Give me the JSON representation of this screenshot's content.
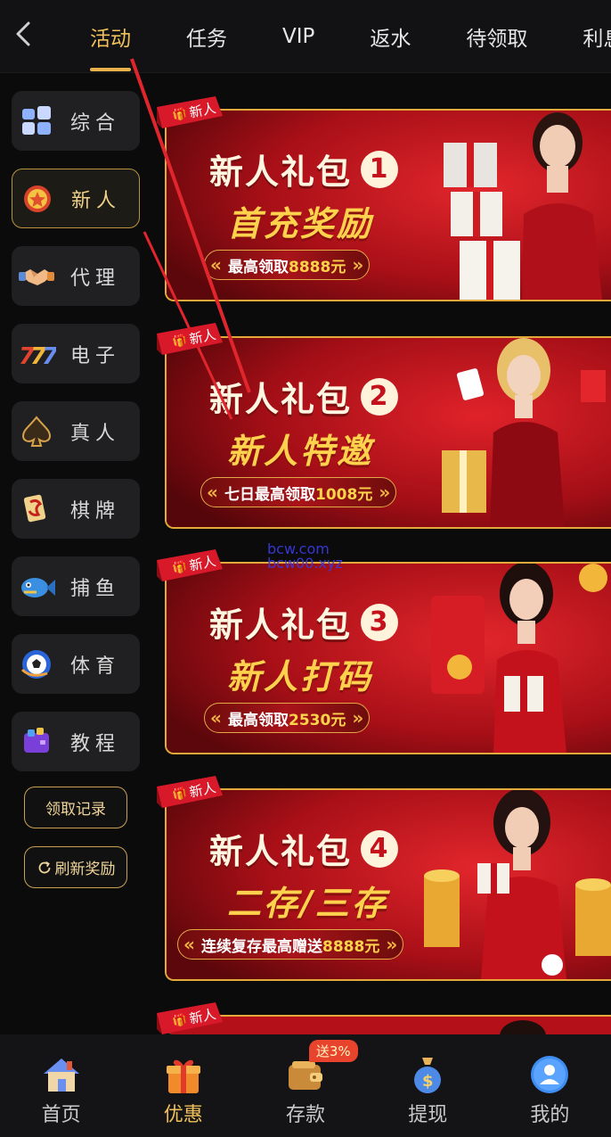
{
  "topbar": {
    "tabs": [
      {
        "label": "活动",
        "active": true
      },
      {
        "label": "任务"
      },
      {
        "label": "VIP"
      },
      {
        "label": "返水"
      },
      {
        "label": "待领取"
      },
      {
        "label": "利息宝"
      }
    ]
  },
  "sidebar": {
    "items": [
      {
        "label": "综合",
        "icon": "grid-icon"
      },
      {
        "label": "新人",
        "icon": "medal-icon",
        "active": true
      },
      {
        "label": "代理",
        "icon": "handshake-icon"
      },
      {
        "label": "电子",
        "icon": "slot-777-icon"
      },
      {
        "label": "真人",
        "icon": "spade-icon"
      },
      {
        "label": "棋牌",
        "icon": "mahjong-icon"
      },
      {
        "label": "捕鱼",
        "icon": "fish-icon"
      },
      {
        "label": "体育",
        "icon": "soccer-icon"
      },
      {
        "label": "教程",
        "icon": "book-icon"
      }
    ],
    "records_label": "领取记录",
    "refresh_label": "刷新奖励"
  },
  "banners": [
    {
      "ribbon": "新人",
      "title": "新人礼包",
      "num": "1",
      "subtitle": "首充奖励",
      "pill_prefix": "最高领取",
      "pill_amount": "8888元"
    },
    {
      "ribbon": "新人",
      "title": "新人礼包",
      "num": "2",
      "subtitle": "新人特邀",
      "pill_prefix": "七日最高领取",
      "pill_amount": "1008元"
    },
    {
      "ribbon": "新人",
      "title": "新人礼包",
      "num": "3",
      "subtitle": "新人打码",
      "pill_prefix": "最高领取",
      "pill_amount": "2530元"
    },
    {
      "ribbon": "新人",
      "title": "新人礼包",
      "num": "4",
      "subtitle": "二存/三存",
      "pill_prefix": "连续复存最高赠送",
      "pill_amount": "8888元"
    },
    {
      "ribbon": "新人"
    }
  ],
  "watermark": {
    "line1": "bcw.com",
    "line2": "bcw00.xyz"
  },
  "bottomnav": {
    "items": [
      {
        "label": "首页",
        "icon": "house-icon"
      },
      {
        "label": "优惠",
        "icon": "gift-icon",
        "active": true
      },
      {
        "label": "存款",
        "icon": "wallet-icon",
        "badge": "送3%"
      },
      {
        "label": "提现",
        "icon": "money-bag-icon"
      },
      {
        "label": "我的",
        "icon": "user-icon"
      }
    ]
  },
  "colors": {
    "accent": "#f0c15a",
    "banner_red": "#b3101a",
    "gold_border": "#e3a93b",
    "background": "#0b0b0c"
  }
}
